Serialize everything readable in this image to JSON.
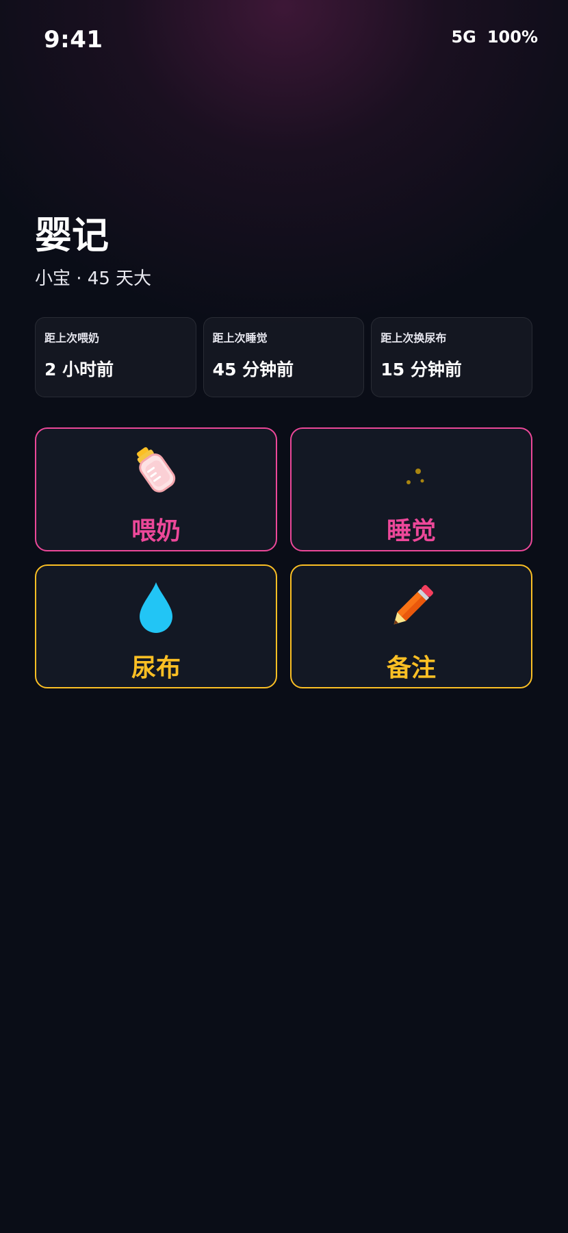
{
  "status_bar": {
    "time": "9:41",
    "network": "5G",
    "battery": "100%"
  },
  "header": {
    "title": "婴记",
    "subtitle": "小宝 · 45 天大"
  },
  "stats": [
    {
      "label": "距上次喂奶",
      "value": "2 小时前"
    },
    {
      "label": "距上次睡觉",
      "value": "45 分钟前"
    },
    {
      "label": "距上次换尿布",
      "value": "15 分钟前"
    }
  ],
  "actions": [
    {
      "label": "喂奶",
      "icon": "baby-bottle-icon",
      "color": "#ec4899"
    },
    {
      "label": "睡觉",
      "icon": "crescent-moon-icon",
      "color": "#ec4899"
    },
    {
      "label": "尿布",
      "icon": "water-drop-icon",
      "color": "#fbbf24"
    },
    {
      "label": "备注",
      "icon": "pencil-icon",
      "color": "#fbbf24"
    }
  ],
  "colors": {
    "background": "#0a0d17",
    "pink_accent": "#ec4899",
    "amber_accent": "#fbbf24"
  }
}
